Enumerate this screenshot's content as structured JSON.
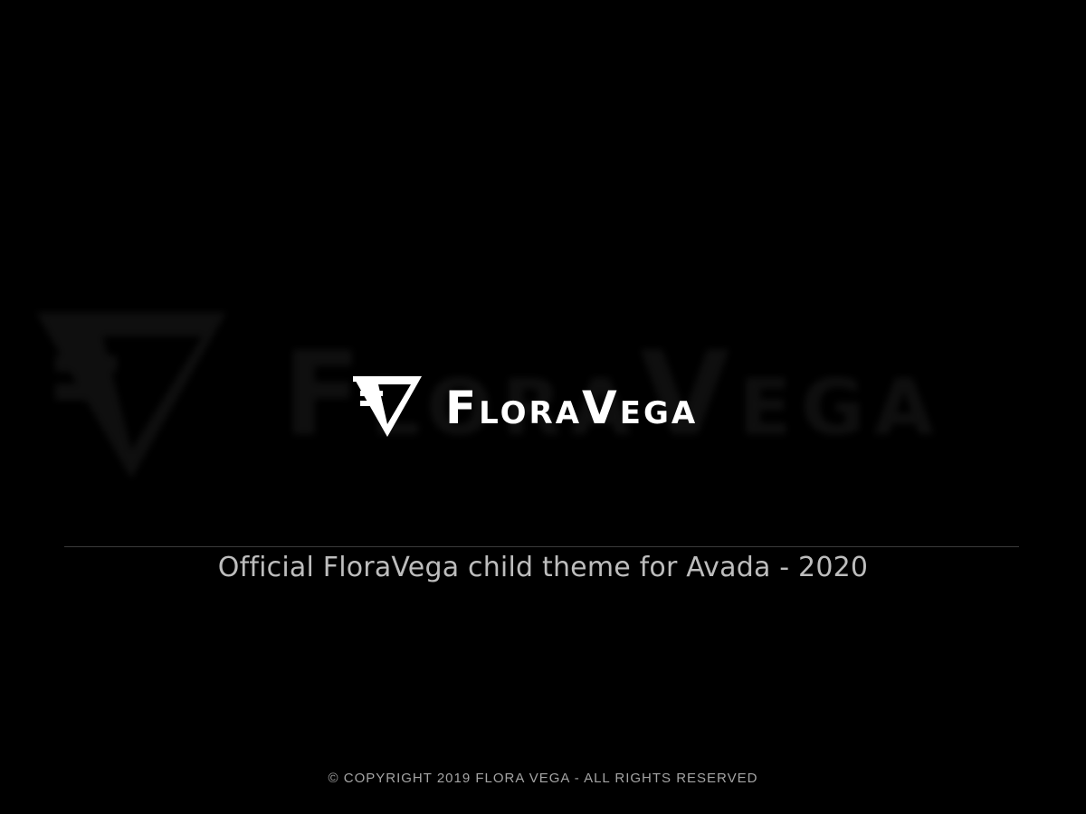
{
  "brand": {
    "name": "FloraVega",
    "wordmark": {
      "cap1": "F",
      "rest1": "LORA",
      "cap2": "V",
      "rest2": "EGA"
    },
    "logo_icon": "fv-triangle-logo-icon"
  },
  "tagline": "Official FloraVega child theme for Avada - 2020",
  "footer": {
    "copyright": "© COPYRIGHT 2019 FLORA VEGA - ALL RIGHTS RESERVED"
  },
  "colors": {
    "background": "#000000",
    "logo": "#ffffff",
    "background_logo": "#1c1c1c",
    "tagline": "#bdbdbd",
    "copyright": "#a4a4a4",
    "divider": "#3a3a3a"
  }
}
